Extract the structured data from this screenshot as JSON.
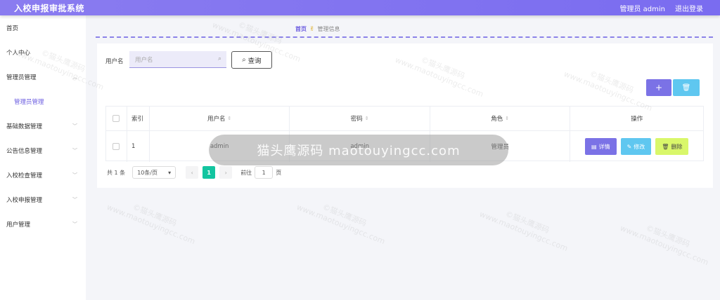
{
  "header": {
    "title": "入校申报审批系统",
    "admin_label": "管理员 admin",
    "logout_label": "退出登录"
  },
  "sidebar": {
    "items": [
      {
        "label": "首页",
        "has_arrow": false
      },
      {
        "label": "个人中心",
        "has_arrow": false
      },
      {
        "label": "管理员管理",
        "has_arrow": true,
        "expanded": true
      },
      {
        "label": "管理员管理",
        "sub": true
      },
      {
        "label": "基础数据管理",
        "has_arrow": true
      },
      {
        "label": "公告信息管理",
        "has_arrow": true
      },
      {
        "label": "入校检查管理",
        "has_arrow": true
      },
      {
        "label": "入校申报管理",
        "has_arrow": true
      },
      {
        "label": "用户管理",
        "has_arrow": true
      }
    ]
  },
  "breadcrumb": {
    "home": "首页",
    "current": "管理信息"
  },
  "search": {
    "label": "用户名",
    "placeholder": "用户名",
    "query_label": "查询"
  },
  "toolbar": {
    "add_label": "+",
    "delete_label": "🗑"
  },
  "table": {
    "headers": {
      "index": "索引",
      "username": "用户名",
      "password": "密码",
      "role": "角色",
      "operation": "操作"
    },
    "rows": [
      {
        "index": "1",
        "username": "admin",
        "password": "admin",
        "role": "管理员"
      }
    ],
    "actions": {
      "detail": "详情",
      "edit": "修改",
      "delete": "删除"
    }
  },
  "pagination": {
    "total": "共 1 条",
    "page_size": "10条/页",
    "current_page": "1",
    "goto_label": "前往",
    "goto_value": "1",
    "page_suffix": "页"
  },
  "watermark": {
    "banner": "猫头鹰源码 maotouyingcc.com",
    "line1": "©猫头鹰源码",
    "line2": "www.maotouyingcc.com"
  },
  "colors": {
    "header": "#7a6cf0",
    "accent": "#6b5ce0",
    "add_button": "#7b72e6",
    "edit_button": "#5fc7f0",
    "delete_button": "#d9f76a",
    "page_active": "#13c5a0"
  }
}
